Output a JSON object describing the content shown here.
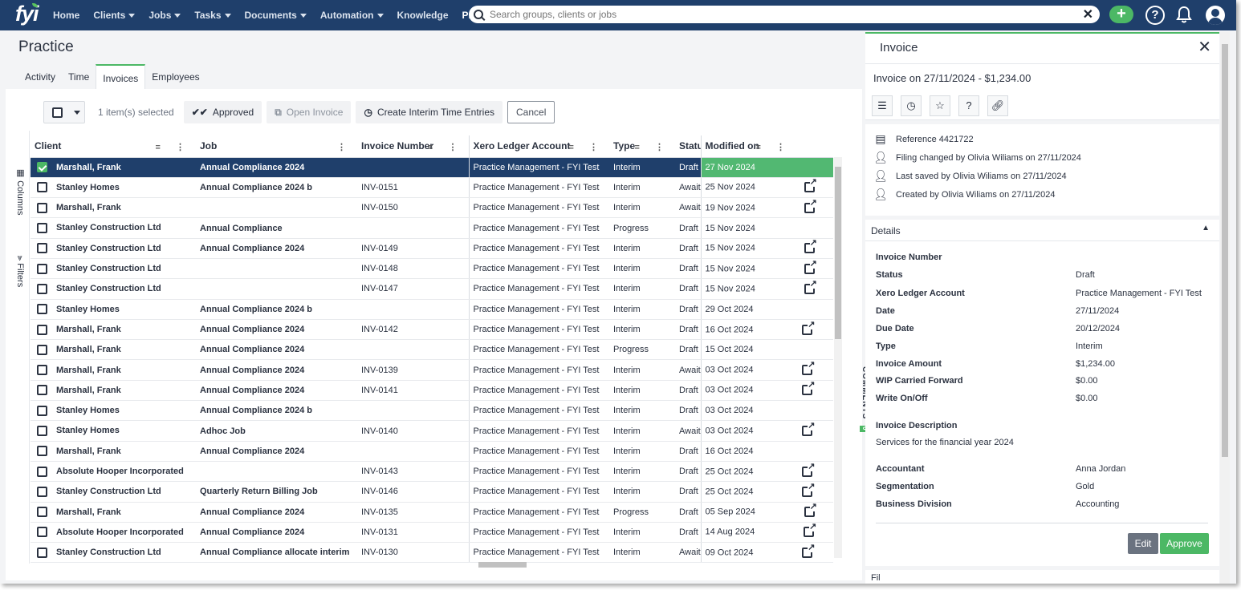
{
  "nav": {
    "logo": "fyi",
    "items": [
      {
        "label": "Home",
        "caret": false
      },
      {
        "label": "Clients",
        "caret": true
      },
      {
        "label": "Jobs",
        "caret": true
      },
      {
        "label": "Tasks",
        "caret": true
      },
      {
        "label": "Documents",
        "caret": true
      },
      {
        "label": "Automation",
        "caret": true
      },
      {
        "label": "Knowledge",
        "caret": false
      },
      {
        "label": "Practice",
        "caret": false,
        "active": true
      }
    ],
    "search_placeholder": "Search groups, clients or jobs",
    "icons": [
      "plus-icon",
      "help-icon",
      "bell-icon",
      "user-icon"
    ]
  },
  "page": {
    "title": "Practice",
    "tabs": [
      "Activity",
      "Time",
      "Invoices",
      "Employees"
    ],
    "active_tab": "Invoices"
  },
  "toolbar": {
    "selected_text": "1 item(s) selected",
    "approved": "Approved",
    "open_invoice": "Open Invoice",
    "create_interim": "Create Interim Time Entries",
    "cancel": "Cancel"
  },
  "side_tabs": {
    "columns": "Columns",
    "filters": "Filters"
  },
  "grid": {
    "columns": [
      "Client",
      "Job",
      "Invoice Number",
      "Xero Ledger Account",
      "Type",
      "Status",
      "Modified on"
    ],
    "rows": [
      {
        "client": "Marshall, Frank",
        "job": "Annual Compliance 2024",
        "invoice": "",
        "ledger": "Practice Management - FYI Test",
        "type": "Interim",
        "status": "Draft",
        "modified": "27 Nov 2024",
        "link": false,
        "selected": true
      },
      {
        "client": "Stanley Homes",
        "job": "Annual Compliance 2024 b",
        "invoice": "INV-0151",
        "ledger": "Practice Management - FYI Test",
        "type": "Interim",
        "status": "Await",
        "modified": "25 Nov 2024",
        "link": true
      },
      {
        "client": "Marshall, Frank",
        "job": "",
        "invoice": "INV-0150",
        "ledger": "Practice Management - FYI Test",
        "type": "Interim",
        "status": "Await",
        "modified": "19 Nov 2024",
        "link": true
      },
      {
        "client": "Stanley Construction Ltd",
        "job": "Annual Compliance",
        "invoice": "",
        "ledger": "Practice Management - FYI Test",
        "type": "Progress",
        "status": "Draft",
        "modified": "15 Nov 2024",
        "link": false
      },
      {
        "client": "Stanley Construction Ltd",
        "job": "Annual Compliance 2024",
        "invoice": "INV-0149",
        "ledger": "Practice Management - FYI Test",
        "type": "Interim",
        "status": "Draft",
        "modified": "15 Nov 2024",
        "link": true
      },
      {
        "client": "Stanley Construction Ltd",
        "job": "",
        "invoice": "INV-0148",
        "ledger": "Practice Management - FYI Test",
        "type": "Interim",
        "status": "Draft",
        "modified": "15 Nov 2024",
        "link": true
      },
      {
        "client": "Stanley Construction Ltd",
        "job": "",
        "invoice": "INV-0147",
        "ledger": "Practice Management - FYI Test",
        "type": "Interim",
        "status": "Draft",
        "modified": "15 Nov 2024",
        "link": true
      },
      {
        "client": "Stanley Homes",
        "job": "Annual Compliance 2024 b",
        "invoice": "",
        "ledger": "Practice Management - FYI Test",
        "type": "Interim",
        "status": "Draft",
        "modified": "29 Oct 2024",
        "link": false
      },
      {
        "client": "Marshall, Frank",
        "job": "Annual Compliance 2024",
        "invoice": "INV-0142",
        "ledger": "Practice Management - FYI Test",
        "type": "Interim",
        "status": "Draft",
        "modified": "16 Oct 2024",
        "link": true
      },
      {
        "client": "Marshall, Frank",
        "job": "Annual Compliance 2024",
        "invoice": "",
        "ledger": "Practice Management - FYI Test",
        "type": "Progress",
        "status": "Draft",
        "modified": "15 Oct 2024",
        "link": false
      },
      {
        "client": "Marshall, Frank",
        "job": "Annual Compliance 2024",
        "invoice": "INV-0139",
        "ledger": "Practice Management - FYI Test",
        "type": "Interim",
        "status": "Await",
        "modified": "03 Oct 2024",
        "link": true
      },
      {
        "client": "Marshall, Frank",
        "job": "Annual Compliance 2024",
        "invoice": "INV-0141",
        "ledger": "Practice Management - FYI Test",
        "type": "Interim",
        "status": "Draft",
        "modified": "03 Oct 2024",
        "link": true
      },
      {
        "client": "Stanley Homes",
        "job": "Annual Compliance 2024 b",
        "invoice": "",
        "ledger": "Practice Management - FYI Test",
        "type": "Interim",
        "status": "Draft",
        "modified": "03 Oct 2024",
        "link": false
      },
      {
        "client": "Stanley Homes",
        "job": "Adhoc Job",
        "invoice": "INV-0140",
        "ledger": "Practice Management - FYI Test",
        "type": "Interim",
        "status": "Await",
        "modified": "03 Oct 2024",
        "link": true
      },
      {
        "client": "Marshall, Frank",
        "job": "Annual Compliance 2024",
        "invoice": "",
        "ledger": "Practice Management - FYI Test",
        "type": "Interim",
        "status": "Draft",
        "modified": "16 Oct 2024",
        "link": false
      },
      {
        "client": "Absolute Hooper Incorporated",
        "job": "",
        "invoice": "INV-0143",
        "ledger": "Practice Management - FYI Test",
        "type": "Interim",
        "status": "Draft",
        "modified": "25 Oct 2024",
        "link": true
      },
      {
        "client": "Stanley Construction Ltd",
        "job": "Quarterly Return Billing Job",
        "invoice": "INV-0146",
        "ledger": "Practice Management - FYI Test",
        "type": "Interim",
        "status": "Draft",
        "modified": "25 Oct 2024",
        "link": true
      },
      {
        "client": "Marshall, Frank",
        "job": "Annual Compliance 2024",
        "invoice": "INV-0135",
        "ledger": "Practice Management - FYI Test",
        "type": "Progress",
        "status": "Draft",
        "modified": "05 Sep 2024",
        "link": true
      },
      {
        "client": "Absolute Hooper Incorporated",
        "job": "Annual Compliance 2024",
        "invoice": "INV-0131",
        "ledger": "Practice Management - FYI Test",
        "type": "Interim",
        "status": "Draft",
        "modified": "14 Aug 2024",
        "link": true
      },
      {
        "client": "Stanley Construction Ltd",
        "job": "Annual Compliance allocate interim",
        "invoice": "INV-0130",
        "ledger": "Practice Management - FYI Test",
        "type": "Interim",
        "status": "Await",
        "modified": "09 Oct 2024",
        "link": true
      }
    ]
  },
  "comments": {
    "label": "COMMENTS",
    "count": "0"
  },
  "panel": {
    "title": "Invoice",
    "subtitle": "Invoice on 27/11/2024 - $1,234.00",
    "audit": [
      {
        "icon": "document-icon",
        "text": "Reference 4421722"
      },
      {
        "icon": "user-edit-icon",
        "text": "Filing changed by Olivia Wiliams on 27/11/2024"
      },
      {
        "icon": "user-edit-icon",
        "text": "Last saved by Olivia Wiliams on 27/11/2024"
      },
      {
        "icon": "user-add-icon",
        "text": "Created by Olivia Wiliams on 27/11/2024"
      }
    ],
    "details_title": "Details",
    "details": [
      {
        "label": "Invoice Number",
        "value": ""
      },
      {
        "label": "Status",
        "value": "Draft"
      },
      {
        "label": "Xero Ledger Account",
        "value": "Practice Management - FYI Test"
      },
      {
        "label": "Date",
        "value": "27/11/2024"
      },
      {
        "label": "Due Date",
        "value": "20/12/2024"
      },
      {
        "label": "Type",
        "value": "Interim"
      },
      {
        "label": "Invoice Amount",
        "value": "$1,234.00"
      },
      {
        "label": "WIP Carried Forward",
        "value": "$0.00"
      },
      {
        "label": "Write On/Off",
        "value": "$0.00"
      }
    ],
    "description_label": "Invoice Description",
    "description_value": "Services for the financial year  2024",
    "extra": [
      {
        "label": "Accountant",
        "value": "Anna Jordan"
      },
      {
        "label": "Segmentation",
        "value": "Gold"
      },
      {
        "label": "Business Division",
        "value": "Accounting"
      }
    ],
    "edit": "Edit",
    "approve": "Approve",
    "next_section": "Fil"
  }
}
